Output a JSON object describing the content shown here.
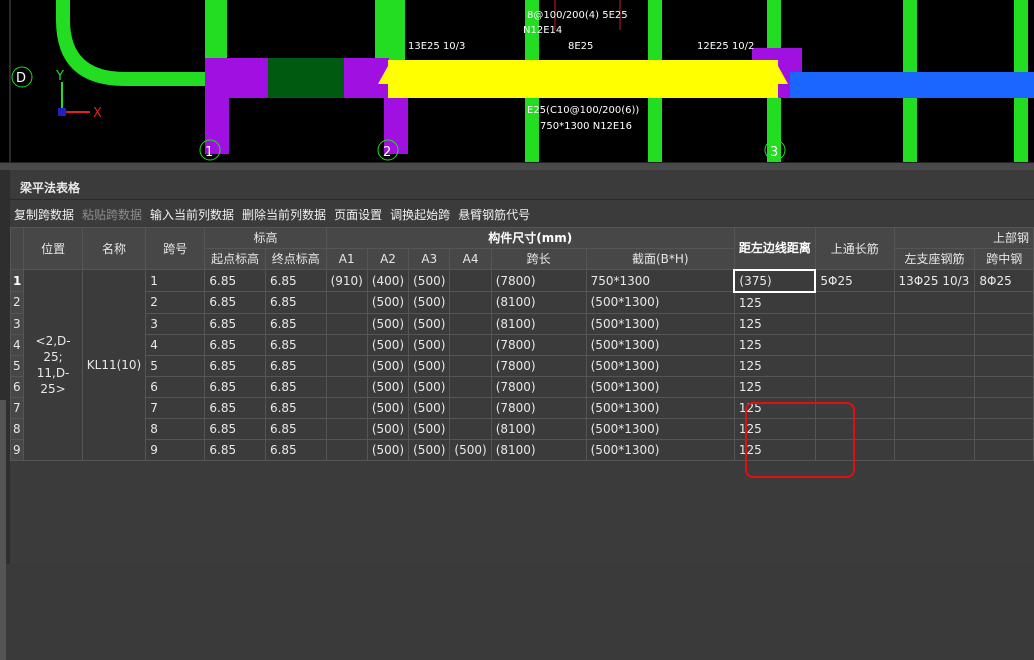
{
  "cad": {
    "axis_labels": {
      "row_d": "D",
      "col_1": "1",
      "col_2": "2",
      "col_3": "3"
    },
    "ucs": {
      "y": "Y",
      "x": "X"
    },
    "annotations": {
      "top_left_cut": "13E25 10/3",
      "top_mid": "8E25",
      "top_right": "12E25 10/2",
      "top_a": "8@100/200(4) 5E25",
      "top_b": "N12E14",
      "bottom_a": "E25(C10@100/200(6))",
      "bottom_b": "750*1300 N12E16"
    },
    "colors": {
      "green": "#22dd22",
      "purple": "#a010e0",
      "yellow": "#ffff00",
      "blue": "#1a66ff",
      "dark_green": "#005a10"
    }
  },
  "panel": {
    "title": "梁平法表格",
    "toolbar": [
      {
        "label": "复制跨数据",
        "enabled": true
      },
      {
        "label": "粘贴跨数据",
        "enabled": false
      },
      {
        "label": "输入当前列数据",
        "enabled": true
      },
      {
        "label": "删除当前列数据",
        "enabled": true
      },
      {
        "label": "页面设置",
        "enabled": true
      },
      {
        "label": "调换起始跨",
        "enabled": true
      },
      {
        "label": "悬臂钢筋代号",
        "enabled": true
      }
    ]
  },
  "table": {
    "headers": {
      "position": "位置",
      "name": "名称",
      "span_no": "跨号",
      "elevation": "标高",
      "start_elev": "起点标高",
      "end_elev": "终点标高",
      "dims_group": "构件尺寸(mm)",
      "a1": "A1",
      "a2": "A2",
      "a3": "A3",
      "a4": "A4",
      "span_len": "跨长",
      "section": "截面(B*H)",
      "left_edge_dist": "距左边线距离",
      "top_through": "上通长筋",
      "top_group": "上部钢",
      "left_support": "左支座钢筋",
      "mid_span": "跨中钢"
    },
    "merged": {
      "position": "<2,D-25; 11,D-25>",
      "name": "KL11(10)"
    },
    "rows": [
      {
        "rn": "1",
        "span": "1",
        "start": "6.85",
        "end": "6.85",
        "a1": "(910)",
        "a2": "(400)",
        "a3": "(500)",
        "a4": "",
        "len": "(7800)",
        "section": "750*1300",
        "dist": "(375)",
        "through": "5Φ25",
        "left": "13Φ25 10/3",
        "mid": "8Φ25"
      },
      {
        "rn": "2",
        "span": "2",
        "start": "6.85",
        "end": "6.85",
        "a1": "",
        "a2": "(500)",
        "a3": "(500)",
        "a4": "",
        "len": "(8100)",
        "section": "(500*1300)",
        "dist": "125",
        "through": "",
        "left": "",
        "mid": ""
      },
      {
        "rn": "3",
        "span": "3",
        "start": "6.85",
        "end": "6.85",
        "a1": "",
        "a2": "(500)",
        "a3": "(500)",
        "a4": "",
        "len": "(8100)",
        "section": "(500*1300)",
        "dist": "125",
        "through": "",
        "left": "",
        "mid": ""
      },
      {
        "rn": "4",
        "span": "4",
        "start": "6.85",
        "end": "6.85",
        "a1": "",
        "a2": "(500)",
        "a3": "(500)",
        "a4": "",
        "len": "(7800)",
        "section": "(500*1300)",
        "dist": "125",
        "through": "",
        "left": "",
        "mid": ""
      },
      {
        "rn": "5",
        "span": "5",
        "start": "6.85",
        "end": "6.85",
        "a1": "",
        "a2": "(500)",
        "a3": "(500)",
        "a4": "",
        "len": "(7800)",
        "section": "(500*1300)",
        "dist": "125",
        "through": "",
        "left": "",
        "mid": ""
      },
      {
        "rn": "6",
        "span": "6",
        "start": "6.85",
        "end": "6.85",
        "a1": "",
        "a2": "(500)",
        "a3": "(500)",
        "a4": "",
        "len": "(7800)",
        "section": "(500*1300)",
        "dist": "125",
        "through": "",
        "left": "",
        "mid": ""
      },
      {
        "rn": "7",
        "span": "7",
        "start": "6.85",
        "end": "6.85",
        "a1": "",
        "a2": "(500)",
        "a3": "(500)",
        "a4": "",
        "len": "(7800)",
        "section": "(500*1300)",
        "dist": "125",
        "through": "",
        "left": "",
        "mid": ""
      },
      {
        "rn": "8",
        "span": "8",
        "start": "6.85",
        "end": "6.85",
        "a1": "",
        "a2": "(500)",
        "a3": "(500)",
        "a4": "",
        "len": "(8100)",
        "section": "(500*1300)",
        "dist": "125",
        "through": "",
        "left": "",
        "mid": ""
      },
      {
        "rn": "9",
        "span": "9",
        "start": "6.85",
        "end": "6.85",
        "a1": "",
        "a2": "(500)",
        "a3": "(500)",
        "a4": "(500)",
        "len": "(8100)",
        "section": "(500*1300)",
        "dist": "125",
        "through": "",
        "left": "",
        "mid": ""
      }
    ]
  }
}
